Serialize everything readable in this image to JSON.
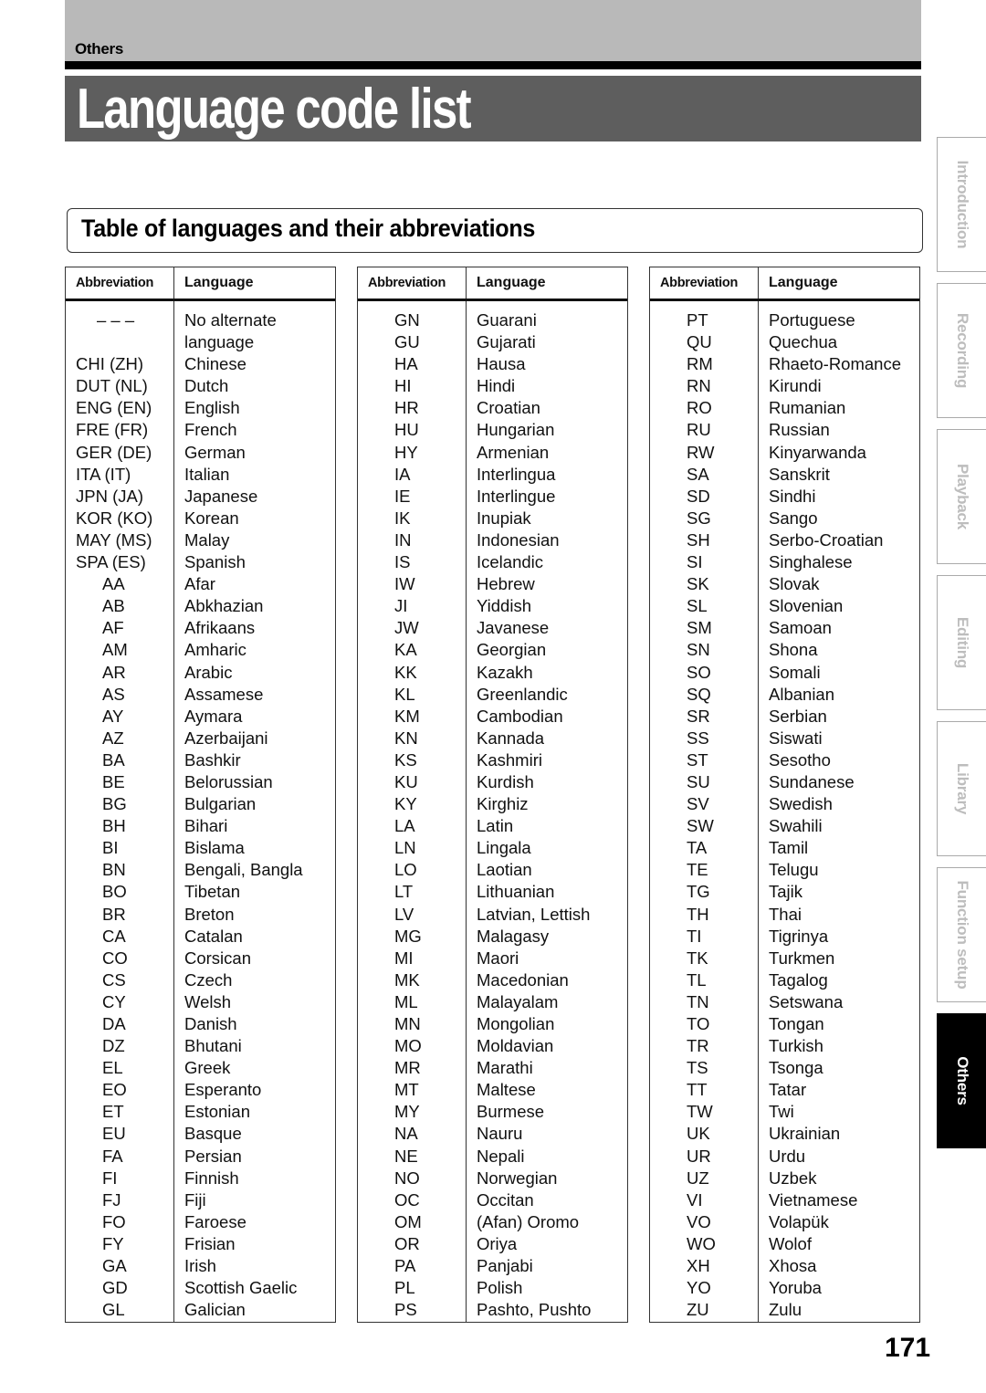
{
  "header": {
    "section_label": "Others",
    "page_title": "Language code list"
  },
  "subheading": "Table of languages and their abbreviations",
  "table_headers": {
    "abbreviation": "Abbreviation",
    "language": "Language"
  },
  "tables": [
    {
      "rows": [
        {
          "abbr": "– – –",
          "lang": "No alternate"
        },
        {
          "abbr": "",
          "lang": "language"
        },
        {
          "abbr": "CHI (ZH)",
          "lang": "Chinese"
        },
        {
          "abbr": "DUT (NL)",
          "lang": "Dutch"
        },
        {
          "abbr": "ENG (EN)",
          "lang": "English"
        },
        {
          "abbr": "FRE (FR)",
          "lang": "French"
        },
        {
          "abbr": "GER (DE)",
          "lang": "German"
        },
        {
          "abbr": "ITA (IT)",
          "lang": "Italian"
        },
        {
          "abbr": "JPN (JA)",
          "lang": "Japanese"
        },
        {
          "abbr": "KOR (KO)",
          "lang": "Korean"
        },
        {
          "abbr": "MAY (MS)",
          "lang": "Malay"
        },
        {
          "abbr": "SPA (ES)",
          "lang": "Spanish"
        },
        {
          "abbr": "AA",
          "lang": "Afar"
        },
        {
          "abbr": "AB",
          "lang": "Abkhazian"
        },
        {
          "abbr": "AF",
          "lang": "Afrikaans"
        },
        {
          "abbr": "AM",
          "lang": "Amharic"
        },
        {
          "abbr": "AR",
          "lang": "Arabic"
        },
        {
          "abbr": "AS",
          "lang": "Assamese"
        },
        {
          "abbr": "AY",
          "lang": "Aymara"
        },
        {
          "abbr": "AZ",
          "lang": "Azerbaijani"
        },
        {
          "abbr": "BA",
          "lang": "Bashkir"
        },
        {
          "abbr": "BE",
          "lang": "Belorussian"
        },
        {
          "abbr": "BG",
          "lang": "Bulgarian"
        },
        {
          "abbr": "BH",
          "lang": "Bihari"
        },
        {
          "abbr": "BI",
          "lang": "Bislama"
        },
        {
          "abbr": "BN",
          "lang": "Bengali, Bangla"
        },
        {
          "abbr": "BO",
          "lang": "Tibetan"
        },
        {
          "abbr": "BR",
          "lang": "Breton"
        },
        {
          "abbr": "CA",
          "lang": "Catalan"
        },
        {
          "abbr": "CO",
          "lang": "Corsican"
        },
        {
          "abbr": "CS",
          "lang": "Czech"
        },
        {
          "abbr": "CY",
          "lang": "Welsh"
        },
        {
          "abbr": "DA",
          "lang": "Danish"
        },
        {
          "abbr": "DZ",
          "lang": "Bhutani"
        },
        {
          "abbr": "EL",
          "lang": "Greek"
        },
        {
          "abbr": "EO",
          "lang": "Esperanto"
        },
        {
          "abbr": "ET",
          "lang": "Estonian"
        },
        {
          "abbr": "EU",
          "lang": "Basque"
        },
        {
          "abbr": "FA",
          "lang": "Persian"
        },
        {
          "abbr": "FI",
          "lang": "Finnish"
        },
        {
          "abbr": "FJ",
          "lang": "Fiji"
        },
        {
          "abbr": "FO",
          "lang": "Faroese"
        },
        {
          "abbr": "FY",
          "lang": "Frisian"
        },
        {
          "abbr": "GA",
          "lang": "Irish"
        },
        {
          "abbr": "GD",
          "lang": "Scottish Gaelic"
        },
        {
          "abbr": "GL",
          "lang": "Galician"
        }
      ]
    },
    {
      "rows": [
        {
          "abbr": "GN",
          "lang": "Guarani"
        },
        {
          "abbr": "GU",
          "lang": "Gujarati"
        },
        {
          "abbr": "HA",
          "lang": "Hausa"
        },
        {
          "abbr": "HI",
          "lang": "Hindi"
        },
        {
          "abbr": "HR",
          "lang": "Croatian"
        },
        {
          "abbr": "HU",
          "lang": "Hungarian"
        },
        {
          "abbr": "HY",
          "lang": "Armenian"
        },
        {
          "abbr": "IA",
          "lang": "Interlingua"
        },
        {
          "abbr": "IE",
          "lang": "Interlingue"
        },
        {
          "abbr": "IK",
          "lang": "Inupiak"
        },
        {
          "abbr": "IN",
          "lang": "Indonesian"
        },
        {
          "abbr": "IS",
          "lang": "Icelandic"
        },
        {
          "abbr": "IW",
          "lang": "Hebrew"
        },
        {
          "abbr": "JI",
          "lang": "Yiddish"
        },
        {
          "abbr": "JW",
          "lang": "Javanese"
        },
        {
          "abbr": "KA",
          "lang": "Georgian"
        },
        {
          "abbr": "KK",
          "lang": "Kazakh"
        },
        {
          "abbr": "KL",
          "lang": "Greenlandic"
        },
        {
          "abbr": "KM",
          "lang": "Cambodian"
        },
        {
          "abbr": "KN",
          "lang": "Kannada"
        },
        {
          "abbr": "KS",
          "lang": "Kashmiri"
        },
        {
          "abbr": "KU",
          "lang": "Kurdish"
        },
        {
          "abbr": "KY",
          "lang": "Kirghiz"
        },
        {
          "abbr": "LA",
          "lang": "Latin"
        },
        {
          "abbr": "LN",
          "lang": "Lingala"
        },
        {
          "abbr": "LO",
          "lang": "Laotian"
        },
        {
          "abbr": "LT",
          "lang": "Lithuanian"
        },
        {
          "abbr": "LV",
          "lang": "Latvian, Lettish"
        },
        {
          "abbr": "MG",
          "lang": "Malagasy"
        },
        {
          "abbr": "MI",
          "lang": "Maori"
        },
        {
          "abbr": "MK",
          "lang": "Macedonian"
        },
        {
          "abbr": "ML",
          "lang": "Malayalam"
        },
        {
          "abbr": "MN",
          "lang": "Mongolian"
        },
        {
          "abbr": "MO",
          "lang": "Moldavian"
        },
        {
          "abbr": "MR",
          "lang": "Marathi"
        },
        {
          "abbr": "MT",
          "lang": "Maltese"
        },
        {
          "abbr": "MY",
          "lang": "Burmese"
        },
        {
          "abbr": "NA",
          "lang": "Nauru"
        },
        {
          "abbr": "NE",
          "lang": "Nepali"
        },
        {
          "abbr": "NO",
          "lang": "Norwegian"
        },
        {
          "abbr": "OC",
          "lang": "Occitan"
        },
        {
          "abbr": "OM",
          "lang": "(Afan) Oromo"
        },
        {
          "abbr": "OR",
          "lang": "Oriya"
        },
        {
          "abbr": "PA",
          "lang": "Panjabi"
        },
        {
          "abbr": "PL",
          "lang": "Polish"
        },
        {
          "abbr": "PS",
          "lang": "Pashto, Pushto"
        }
      ]
    },
    {
      "rows": [
        {
          "abbr": "PT",
          "lang": "Portuguese"
        },
        {
          "abbr": "QU",
          "lang": "Quechua"
        },
        {
          "abbr": "RM",
          "lang": "Rhaeto-Romance"
        },
        {
          "abbr": "RN",
          "lang": "Kirundi"
        },
        {
          "abbr": "RO",
          "lang": "Rumanian"
        },
        {
          "abbr": "RU",
          "lang": "Russian"
        },
        {
          "abbr": "RW",
          "lang": "Kinyarwanda"
        },
        {
          "abbr": "SA",
          "lang": "Sanskrit"
        },
        {
          "abbr": "SD",
          "lang": "Sindhi"
        },
        {
          "abbr": "SG",
          "lang": "Sango"
        },
        {
          "abbr": "SH",
          "lang": "Serbo-Croatian"
        },
        {
          "abbr": "SI",
          "lang": "Singhalese"
        },
        {
          "abbr": "SK",
          "lang": "Slovak"
        },
        {
          "abbr": "SL",
          "lang": "Slovenian"
        },
        {
          "abbr": "SM",
          "lang": "Samoan"
        },
        {
          "abbr": "SN",
          "lang": "Shona"
        },
        {
          "abbr": "SO",
          "lang": "Somali"
        },
        {
          "abbr": "SQ",
          "lang": "Albanian"
        },
        {
          "abbr": "SR",
          "lang": "Serbian"
        },
        {
          "abbr": "SS",
          "lang": "Siswati"
        },
        {
          "abbr": "ST",
          "lang": "Sesotho"
        },
        {
          "abbr": "SU",
          "lang": "Sundanese"
        },
        {
          "abbr": "SV",
          "lang": "Swedish"
        },
        {
          "abbr": "SW",
          "lang": "Swahili"
        },
        {
          "abbr": "TA",
          "lang": "Tamil"
        },
        {
          "abbr": "TE",
          "lang": "Telugu"
        },
        {
          "abbr": "TG",
          "lang": "Tajik"
        },
        {
          "abbr": "TH",
          "lang": "Thai"
        },
        {
          "abbr": "TI",
          "lang": "Tigrinya"
        },
        {
          "abbr": "TK",
          "lang": "Turkmen"
        },
        {
          "abbr": "TL",
          "lang": "Tagalog"
        },
        {
          "abbr": "TN",
          "lang": "Setswana"
        },
        {
          "abbr": "TO",
          "lang": "Tongan"
        },
        {
          "abbr": "TR",
          "lang": "Turkish"
        },
        {
          "abbr": "TS",
          "lang": "Tsonga"
        },
        {
          "abbr": "TT",
          "lang": "Tatar"
        },
        {
          "abbr": "TW",
          "lang": "Twi"
        },
        {
          "abbr": "UK",
          "lang": "Ukrainian"
        },
        {
          "abbr": "UR",
          "lang": "Urdu"
        },
        {
          "abbr": "UZ",
          "lang": "Uzbek"
        },
        {
          "abbr": "VI",
          "lang": "Vietnamese"
        },
        {
          "abbr": "VO",
          "lang": "Volapük"
        },
        {
          "abbr": "WO",
          "lang": "Wolof"
        },
        {
          "abbr": "XH",
          "lang": "Xhosa"
        },
        {
          "abbr": "YO",
          "lang": "Yoruba"
        },
        {
          "abbr": "ZU",
          "lang": "Zulu"
        }
      ]
    }
  ],
  "side_tabs": [
    {
      "label": "Introduction",
      "active": false
    },
    {
      "label": "Recording",
      "active": false
    },
    {
      "label": "Playback",
      "active": false
    },
    {
      "label": "Editing",
      "active": false
    },
    {
      "label": "Library",
      "active": false
    },
    {
      "label": "Function setup",
      "active": false
    },
    {
      "label": "Others",
      "active": true
    }
  ],
  "page_number": "171"
}
